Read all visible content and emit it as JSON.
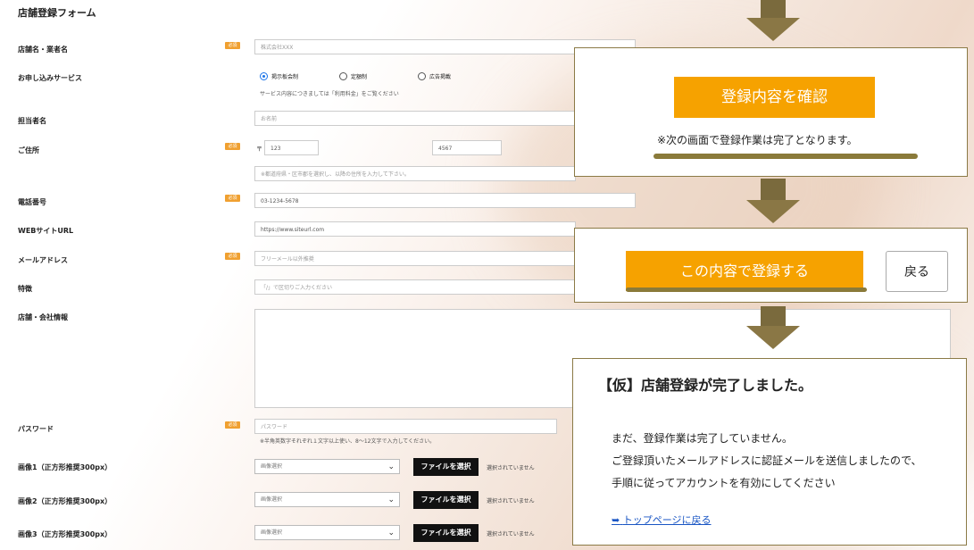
{
  "form": {
    "title": "店舗登録フォーム",
    "required_badge": "必須",
    "fields": {
      "shop_name": {
        "label": "店舗名・業者名",
        "placeholder": "株式会社XXX"
      },
      "service": {
        "label": "お申し込みサービス",
        "options": [
          "掲示板会制",
          "定額制",
          "広告掲載"
        ],
        "selected": "掲示板会制",
        "note": "サービス内容につきましては「利用料金」をご覧ください"
      },
      "person": {
        "label": "担当者名",
        "placeholder": "お名前"
      },
      "address": {
        "label": "ご住所",
        "postal_mark": "〒",
        "zip1": "123",
        "zip2": "4567",
        "placeholder": "※都道府県・区市郡を選択し、以降の住所を入力して下さい。"
      },
      "phone": {
        "label": "電話番号",
        "placeholder": "03-1234-5678"
      },
      "website": {
        "label": "WEBサイトURL",
        "placeholder": "https://www.siteurl.com"
      },
      "email": {
        "label": "メールアドレス",
        "placeholder": "フリーメール以外推奨"
      },
      "features": {
        "label": "特徴",
        "placeholder": "「/」で区切りご入力ください"
      },
      "info": {
        "label": "店舗・会社情報"
      },
      "password": {
        "label": "パスワード",
        "placeholder": "パスワード",
        "note": "※半角英数字それぞれ１文字以上使い、8〜12文字で入力してください。"
      },
      "images": [
        {
          "label": "画像1（正方形推奨300px）",
          "select": "画像選択",
          "button": "ファイルを選択",
          "status": "選択されていません"
        },
        {
          "label": "画像2（正方形推奨300px）",
          "select": "画像選択",
          "button": "ファイルを選択",
          "status": "選択されていません"
        },
        {
          "label": "画像3（正方形推奨300px）",
          "select": "画像選択",
          "button": "ファイルを選択",
          "status": "選択されていません"
        }
      ]
    }
  },
  "confirm_panel": {
    "button": "登録内容を確認",
    "note": "※次の画面で登録作業は完了となります。"
  },
  "submit_panel": {
    "submit": "この内容で登録する",
    "back": "戻る"
  },
  "complete_panel": {
    "title": "【仮】店舗登録が完了しました。",
    "lines": [
      "まだ、登録作業は完了していません。",
      "ご登録頂いたメールアドレスに認証メールを送信しましたので、",
      "手順に従ってアカウントを有効にしてください"
    ],
    "link": "トップページに戻る",
    "link_icon": "exit-icon"
  },
  "colors": {
    "accent": "#f6a200",
    "arrow": "#8a7745",
    "required": "#f0a030"
  }
}
